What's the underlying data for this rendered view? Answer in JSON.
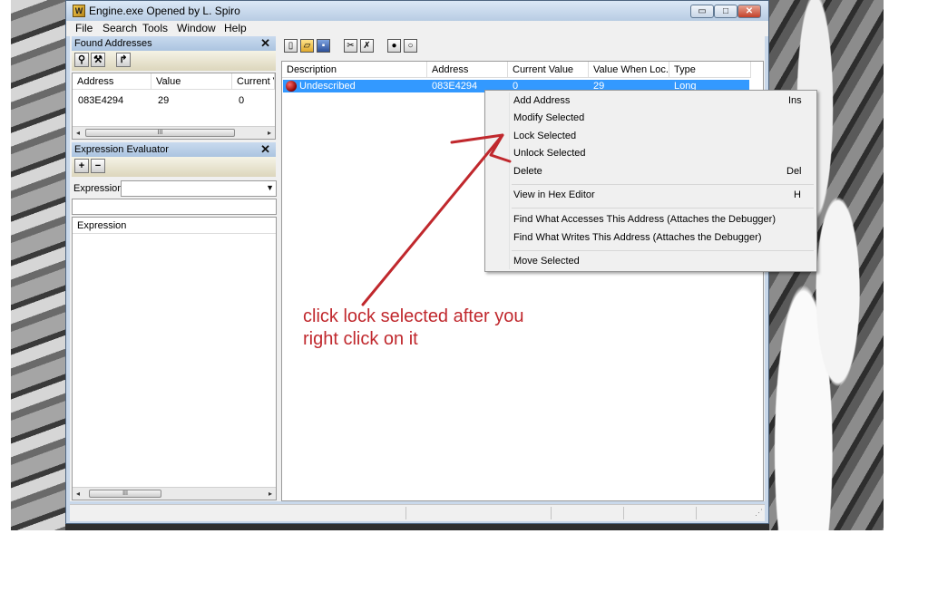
{
  "window": {
    "title": "Engine.exe Opened by L. Spiro",
    "app_icon_glyph": "W",
    "controls": {
      "minimize": "▭",
      "maximize": "□",
      "close": "✕"
    }
  },
  "menubar": [
    "File",
    "Search",
    "Tools",
    "Window",
    "Help"
  ],
  "found_addresses": {
    "title": "Found Addresses",
    "close": "✕",
    "columns": [
      "Address",
      "Value",
      "Current V"
    ],
    "rows": [
      {
        "address": "083E4294",
        "value": "29",
        "current": "0"
      }
    ],
    "scroll_thumb": "III"
  },
  "expression_evaluator": {
    "title": "Expression Evaluator",
    "close": "✕",
    "add_button": "+",
    "remove_button": "−",
    "expression_label": "Expression:",
    "expression_value": "",
    "list_header": "Expression",
    "scroll_thumb": "III"
  },
  "main_list": {
    "columns": [
      "Description",
      "Address",
      "Current Value",
      "Value When Loc...",
      "Type"
    ],
    "rows": [
      {
        "description": "Undescribed",
        "address": "083E4294",
        "current": "0",
        "locked_value": "29",
        "type": "Long"
      }
    ]
  },
  "context_menu": {
    "items": [
      {
        "label": "Add Address",
        "shortcut": "Ins"
      },
      {
        "label": "Modify Selected",
        "shortcut": ""
      },
      {
        "label": "Lock Selected",
        "shortcut": ""
      },
      {
        "label": "Unlock Selected",
        "shortcut": ""
      },
      {
        "label": "Delete",
        "shortcut": "Del"
      },
      {
        "label": "View in Hex Editor",
        "shortcut": "H"
      },
      {
        "label": "Find What Accesses This Address (Attaches the Debugger)",
        "shortcut": ""
      },
      {
        "label": "Find What Writes This Address (Attaches the Debugger)",
        "shortcut": ""
      },
      {
        "label": "Move Selected",
        "shortcut": ""
      }
    ]
  },
  "annotation": {
    "line1": "click lock selected after you",
    "line2": "right click on it",
    "color": "#c0282d"
  },
  "colors": {
    "selection": "#3399ff",
    "titlebar": "#b8cce3",
    "menu_bg": "#f0f0f0"
  }
}
